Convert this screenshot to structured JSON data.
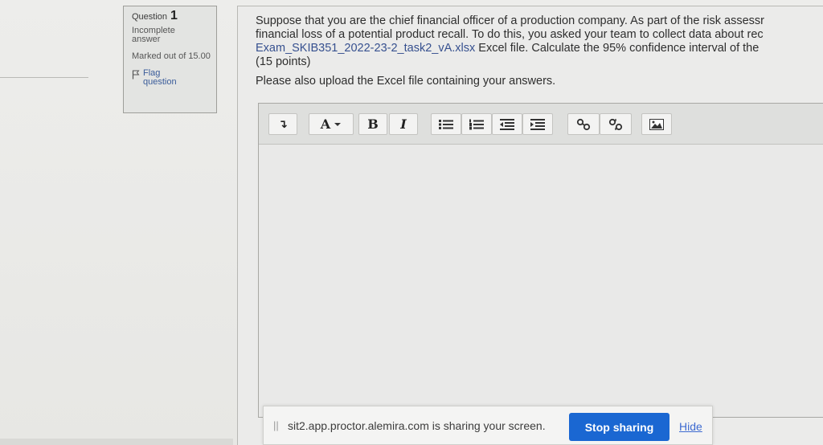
{
  "question_info": {
    "label": "Question",
    "number": "1",
    "state": "Incomplete answer",
    "grade": "Marked out of 15.00",
    "flag_label": "Flag question"
  },
  "question_text": {
    "line1": "Suppose that you are the chief financial officer of a production company. As part of the risk assessr",
    "line2": "financial loss of a potential product recall. To do this, you asked your team to collect data about rec",
    "line3_file": "Exam_SKIB351_2022-23-2_task2_vA.xlsx",
    "line3_rest": " Excel file. Calculate the 95% confidence interval of the",
    "line4": "(15 points)",
    "para2": "Please also upload the Excel file containing your answers."
  },
  "toolbar": {
    "expand_icon": "↴",
    "font_color": "A",
    "bold": "B",
    "italic": "I"
  },
  "share_bar": {
    "grip": "||",
    "message": "sit2.app.proctor.alemira.com is sharing your screen.",
    "stop_label": "Stop sharing",
    "hide_label": "Hide"
  },
  "colors": {
    "link": "#36508f",
    "stop_button": "#1a67d2",
    "hide_link": "#3d6ad0"
  },
  "icons": [
    "expand-toolbar-icon",
    "font-color-icon",
    "bold-icon",
    "italic-icon",
    "unordered-list-icon",
    "ordered-list-icon",
    "outdent-icon",
    "indent-icon",
    "link-icon",
    "unlink-icon",
    "image-icon",
    "flag-icon"
  ]
}
